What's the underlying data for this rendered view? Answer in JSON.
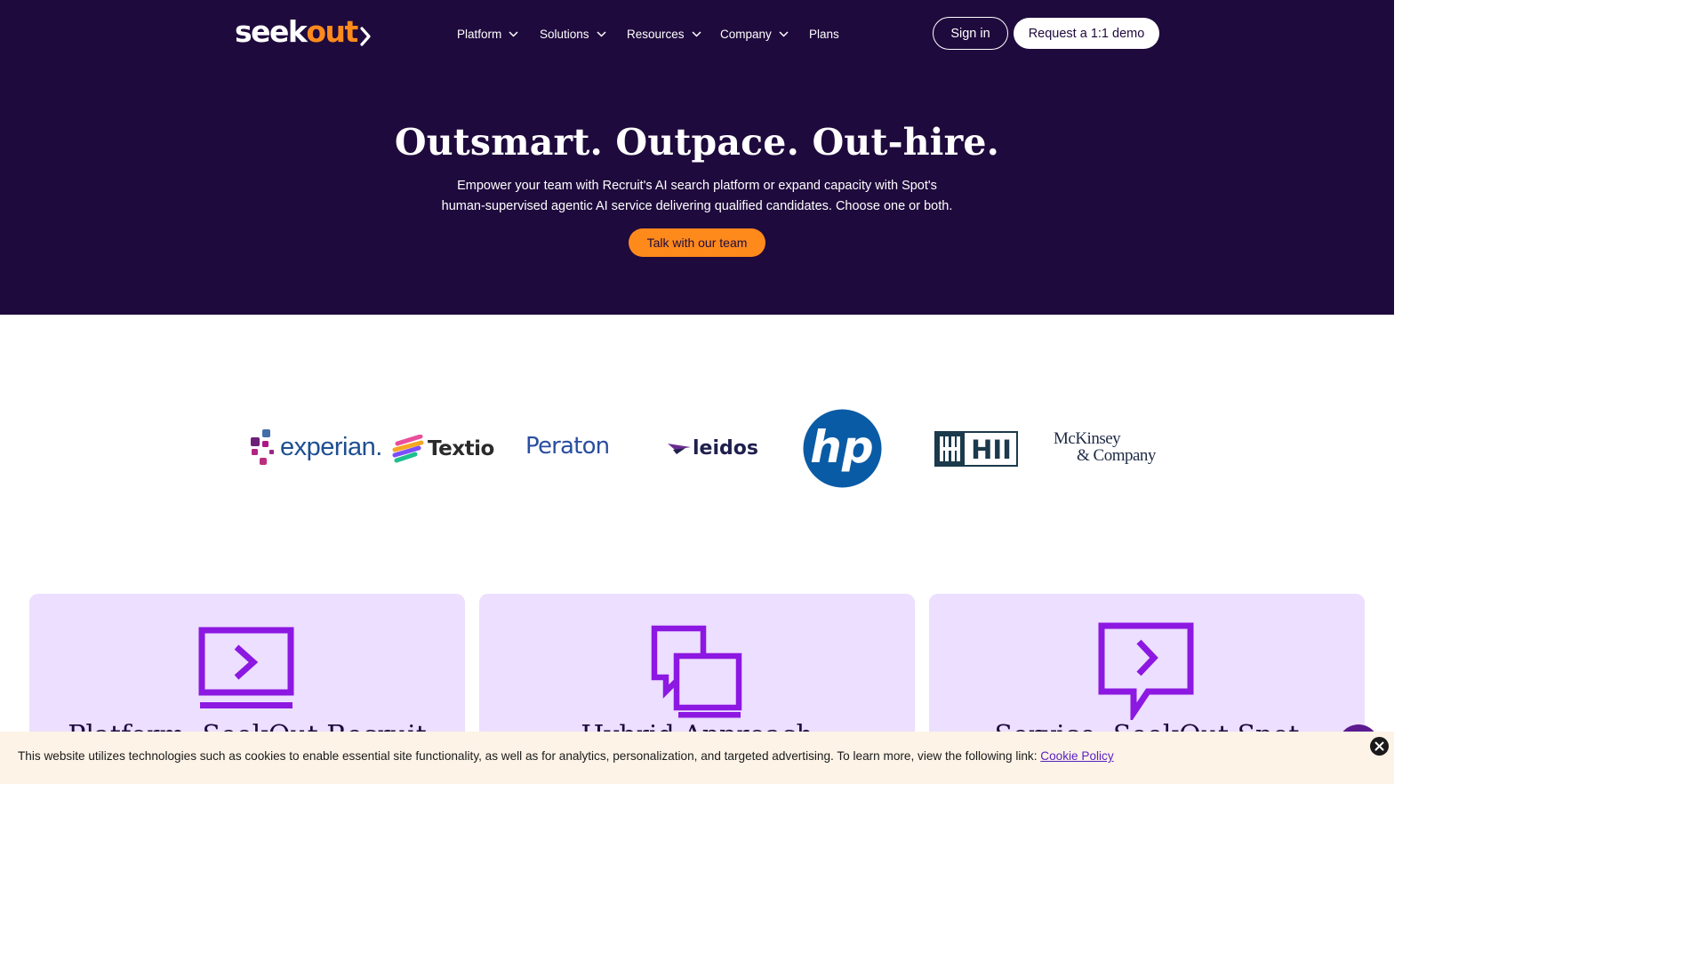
{
  "brand": {
    "logo_part1": "seek",
    "logo_part2": "out",
    "accent": "#ff8a1c",
    "dark_bg": "#1f0a3d"
  },
  "nav": {
    "items": [
      {
        "label": "Platform",
        "has_dropdown": true
      },
      {
        "label": "Solutions",
        "has_dropdown": true
      },
      {
        "label": "Resources",
        "has_dropdown": true
      },
      {
        "label": "Company",
        "has_dropdown": true
      },
      {
        "label": "Plans",
        "has_dropdown": false
      }
    ],
    "signin_label": "Sign in",
    "demo_label": "Request a 1:1 demo"
  },
  "hero": {
    "title": "Outsmart. Outpace. Out-hire.",
    "subtitle_line1": "Empower your team with Recruit's AI search platform or expand capacity with Spot's",
    "subtitle_line2": "human-supervised agentic AI service delivering qualified candidates. Choose one or both.",
    "cta_label": "Talk with our team"
  },
  "customer_logos": [
    {
      "name": "experian",
      "text": "experian."
    },
    {
      "name": "textio",
      "text": "Textio"
    },
    {
      "name": "peraton",
      "text": "Peraton"
    },
    {
      "name": "leidos",
      "text": "leidos"
    },
    {
      "name": "hp",
      "text": "hp"
    },
    {
      "name": "hii",
      "text": "HII"
    },
    {
      "name": "mckinsey",
      "text_line1": "McKinsey",
      "text_line2": "& Company"
    }
  ],
  "cards": [
    {
      "icon": "screen-chevron-icon",
      "title": "Platform: SeekOut Recruit"
    },
    {
      "icon": "overlapping-chat-icon",
      "title": "Hybrid Approach"
    },
    {
      "icon": "chat-chevron-icon",
      "title": "Service: SeekOut Spot"
    }
  ],
  "cookie": {
    "text": "This website utilizes technologies such as cookies to enable essential site functionality, as well as for analytics, personalization, and targeted advertising. To learn more, view the following link:",
    "link_label": "Cookie Policy"
  }
}
